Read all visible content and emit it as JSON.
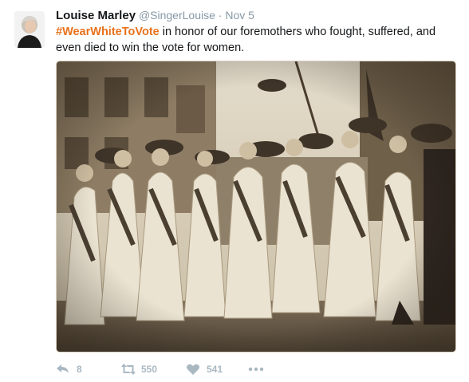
{
  "user": {
    "name": "Louise Marley",
    "handle": "@SingerLouise",
    "separator": "·",
    "date": "Nov 5"
  },
  "tweet": {
    "hashtag": "#WearWhiteToVote",
    "text": " in honor of our foremothers who fought, suffered, and even died to win the vote for women."
  },
  "actions": {
    "reply_count": "8",
    "retweet_count": "550",
    "like_count": "541"
  },
  "icons": {
    "reply": "reply-icon",
    "retweet": "retweet-icon",
    "like": "heart-icon",
    "more": "more-icon"
  },
  "colors": {
    "hashtag": "#e8721c",
    "muted": "#8899a6",
    "action": "#aab8c2"
  }
}
